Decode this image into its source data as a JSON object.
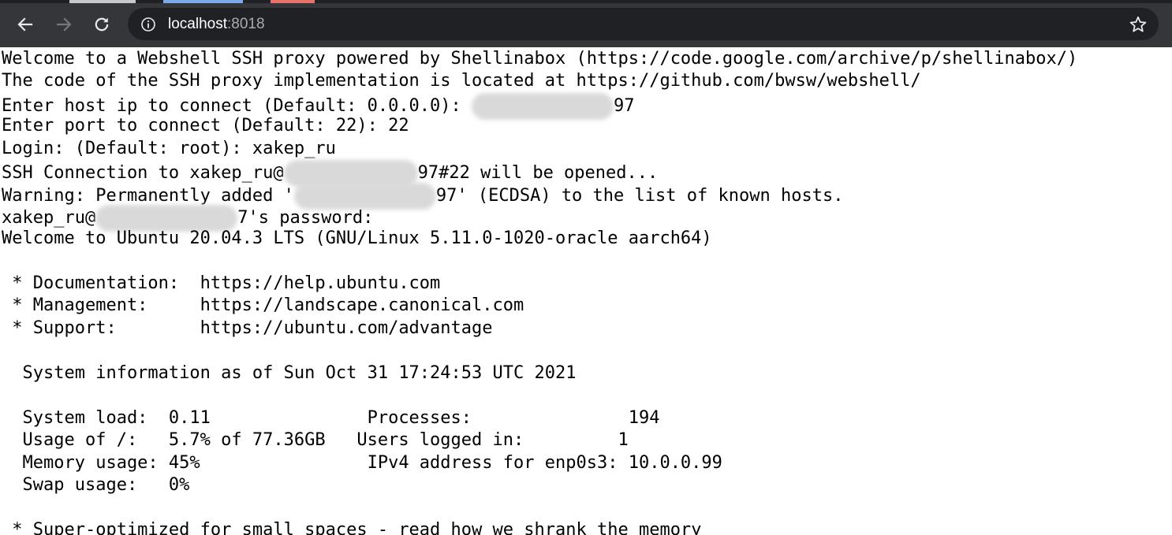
{
  "browser": {
    "url_host": "localhost",
    "url_port": ":8018",
    "icons": {
      "back": "arrow-left-icon",
      "forward": "arrow-right-icon",
      "reload": "reload-icon",
      "site_info": "info-circle-icon",
      "bookmark": "star-outline-icon"
    },
    "colors": {
      "toolbar": "#35363a",
      "omnibox": "#202124"
    }
  },
  "terminal": {
    "banner_line": "Welcome to a Webshell SSH proxy powered by Shellinabox (https://code.google.com/archive/p/shellinabox/)",
    "source_line": "The code of the SSH proxy implementation is located at https://github.com/bwsw/webshell/",
    "host_prompt": "Enter host ip to connect (Default: 0.0.0.0): ",
    "host_tail": "97",
    "port_line": "Enter port to connect (Default: 22): 22",
    "login_line": "Login: (Default: root): xakep_ru",
    "ssh_prefix": "SSH Connection to xakep_ru@",
    "ssh_suffix": "97#22 will be opened...",
    "warn_prefix": "Warning: Permanently added '",
    "warn_suffix": "97' (ECDSA) to the list of known hosts.",
    "pw_prefix": "xakep_ru@",
    "pw_suffix": "7's password:",
    "welcome_line": "Welcome to Ubuntu 20.04.3 LTS (GNU/Linux 5.11.0-1020-oracle aarch64)",
    "doc_line": " * Documentation:  https://help.ubuntu.com",
    "mgmt_line": " * Management:     https://landscape.canonical.com",
    "support_line": " * Support:        https://ubuntu.com/advantage",
    "sysinfo_line": "  System information as of Sun Oct 31 17:24:53 UTC 2021",
    "stats_line_1": "  System load:  0.11               Processes:               194",
    "stats_line_2": "  Usage of /:   5.7% of 77.36GB   Users logged in:         1",
    "stats_line_3": "  Memory usage: 45%                IPv4 address for enp0s3: 10.0.0.99",
    "stats_line_4": "  Swap usage:   0%",
    "tip_line": " * Super-optimized for small spaces - read how we shrank the memory"
  }
}
